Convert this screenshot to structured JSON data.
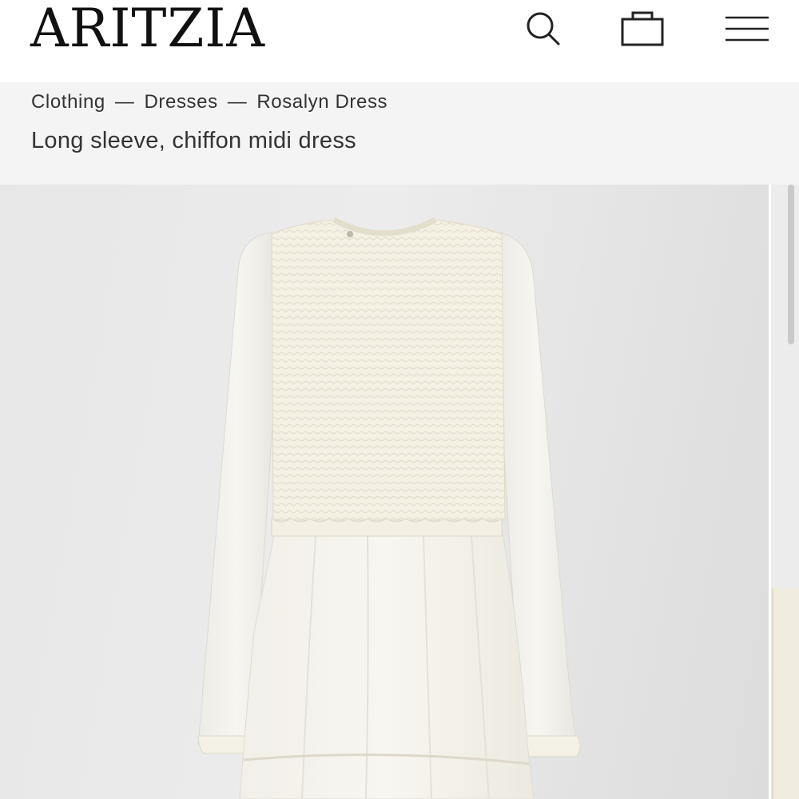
{
  "header": {
    "logo": "ARITZIA",
    "icons": [
      "search-icon",
      "shopping-bag-icon",
      "hamburger-menu-icon"
    ]
  },
  "breadcrumb": {
    "items": [
      "Clothing",
      "Dresses",
      "Rosalyn Dress"
    ],
    "separator": "—"
  },
  "product": {
    "subtitle": "Long sleeve, chiffon midi dress",
    "image_label": "dress-product-photo"
  },
  "colors": {
    "background": "#ffffff",
    "band": "#f4f4f4",
    "text": "#333333",
    "dress": "#f6f3ea"
  }
}
